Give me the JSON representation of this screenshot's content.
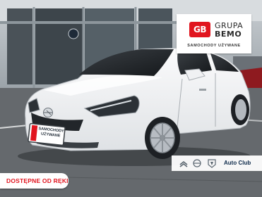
{
  "dealer": {
    "logo_text": "GB",
    "name_line1": "GRUPA",
    "name_line2": "BEMO",
    "tagline": "SAMOCHODY UŻYWANE"
  },
  "plate": {
    "line1": "SAMOCHODY",
    "line2": "UŻYWANE"
  },
  "badges": {
    "availability": "DOSTĘPNE OD RĘKI",
    "club": "Auto Club"
  },
  "colors": {
    "brand_red": "#e1141e",
    "car_body": "#f4f5f6",
    "club_text": "#0d2a4a"
  },
  "icons": [
    "citroen-logo-icon",
    "opel-logo-icon",
    "peugeot-logo-icon"
  ]
}
